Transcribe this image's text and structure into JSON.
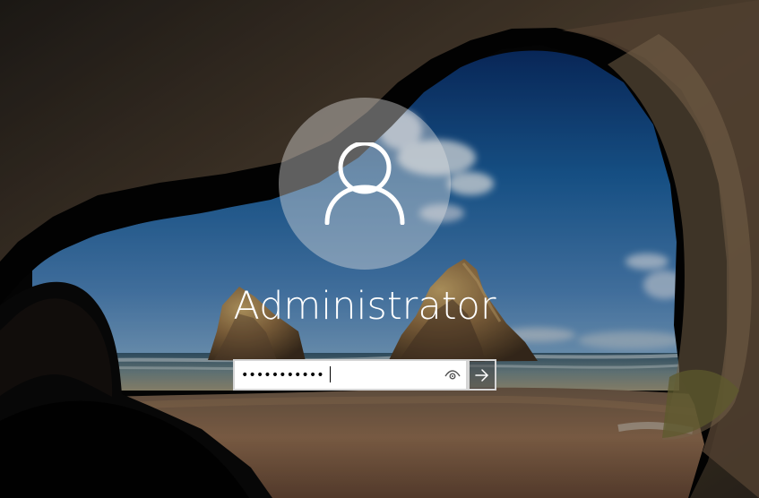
{
  "screen": {
    "type": "windows-sign-in"
  },
  "user": {
    "name": "Administrator",
    "avatar_icon": "user-profile-icon"
  },
  "password": {
    "value": "•••••••••••",
    "reveal_icon": "eye-icon",
    "submit_icon": "arrow-right-icon"
  },
  "colors": {
    "text": "#ffffff",
    "avatar_circle": "#e1e1e1",
    "input_background": "#ffffff",
    "input_border": "#d5d5d5",
    "submit_background": "#464646"
  }
}
